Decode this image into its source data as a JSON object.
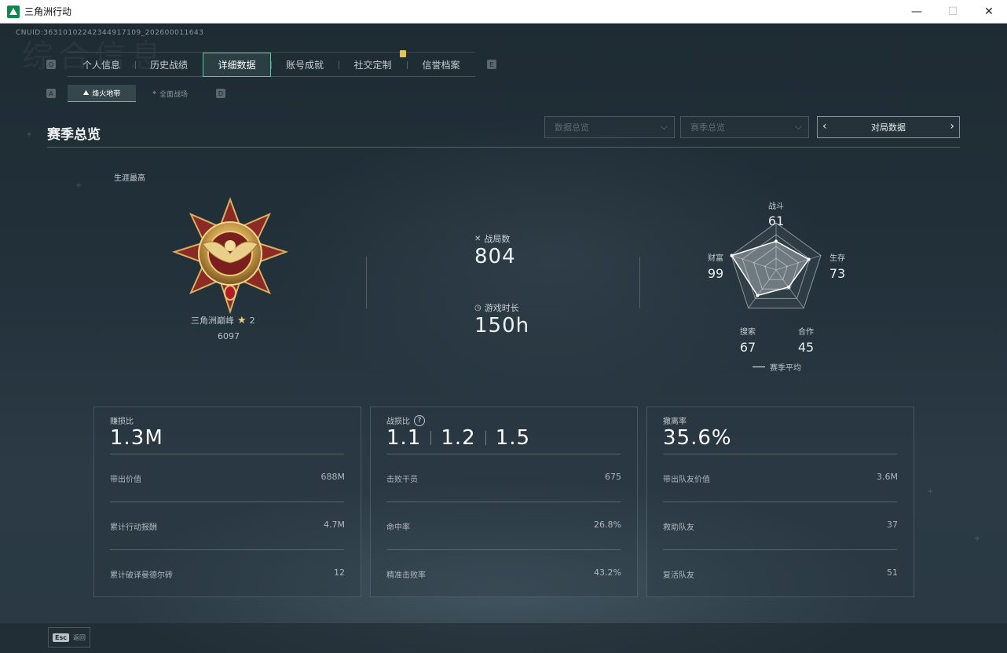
{
  "window": {
    "title": "三角洲行动",
    "minimize": "—",
    "maximize": "☐",
    "close": "✕"
  },
  "uid": "CNUID:3631010224234491710​9_2026000116​43",
  "watermark": "综合信息",
  "tabs": {
    "hint_left": "Q",
    "hint_right": "E",
    "items": [
      {
        "label": "个人信息",
        "active": false
      },
      {
        "label": "历史战绩",
        "active": false
      },
      {
        "label": "详细数据",
        "active": true
      },
      {
        "label": "账号成就",
        "active": false
      },
      {
        "label": "社交定制",
        "active": false
      },
      {
        "label": "信誉档案",
        "active": false
      }
    ]
  },
  "subtabs": {
    "hint_left": "A",
    "hint_right": "D",
    "items": [
      {
        "label": "烽火地带",
        "icon": "mountain-icon",
        "active": true
      },
      {
        "label": "全面战场",
        "icon": "crosshair-icon",
        "active": false
      }
    ]
  },
  "section": {
    "title": "赛季总览",
    "dropdown1": "数据总览",
    "dropdown2": "赛季总览",
    "pager_label": "对局数据"
  },
  "career": {
    "label": "生涯最高",
    "rank_name": "三角洲巅峰",
    "stars": "2",
    "score": "6097"
  },
  "matches": {
    "label": "战局数",
    "value": "804",
    "icon": "swords-icon"
  },
  "playtime": {
    "label": "游戏时长",
    "value": "150h",
    "icon": "clock-icon"
  },
  "radar": {
    "axes": [
      {
        "name": "战斗",
        "value": "61"
      },
      {
        "name": "生存",
        "value": "73"
      },
      {
        "name": "合作",
        "value": "45"
      },
      {
        "name": "搜索",
        "value": "67"
      },
      {
        "name": "财富",
        "value": "99"
      }
    ],
    "scores": [
      61,
      73,
      45,
      67,
      99
    ],
    "legend": "赛季平均"
  },
  "cards": [
    {
      "title": "赚损比",
      "value": "1.3M",
      "rows": [
        {
          "label": "带出价值",
          "value": "688M"
        },
        {
          "label": "累计行动报酬",
          "value": "4.7M"
        },
        {
          "label": "累计破译曼德尔砖",
          "value": "12"
        }
      ]
    },
    {
      "title": "战损比",
      "values": [
        "1.1",
        "1.2",
        "1.5"
      ],
      "rows": [
        {
          "label": "击败干员",
          "value": "675"
        },
        {
          "label": "命中率",
          "value": "26.8%"
        },
        {
          "label": "精准击败率",
          "value": "43.2%"
        }
      ]
    },
    {
      "title": "撤离率",
      "value": "35.6%",
      "rows": [
        {
          "label": "带出队友价值",
          "value": "3.6M"
        },
        {
          "label": "救助队友",
          "value": "37"
        },
        {
          "label": "复活队友",
          "value": "51"
        }
      ]
    }
  ],
  "footer": {
    "esc_key": "Esc",
    "esc_label": "返回"
  }
}
